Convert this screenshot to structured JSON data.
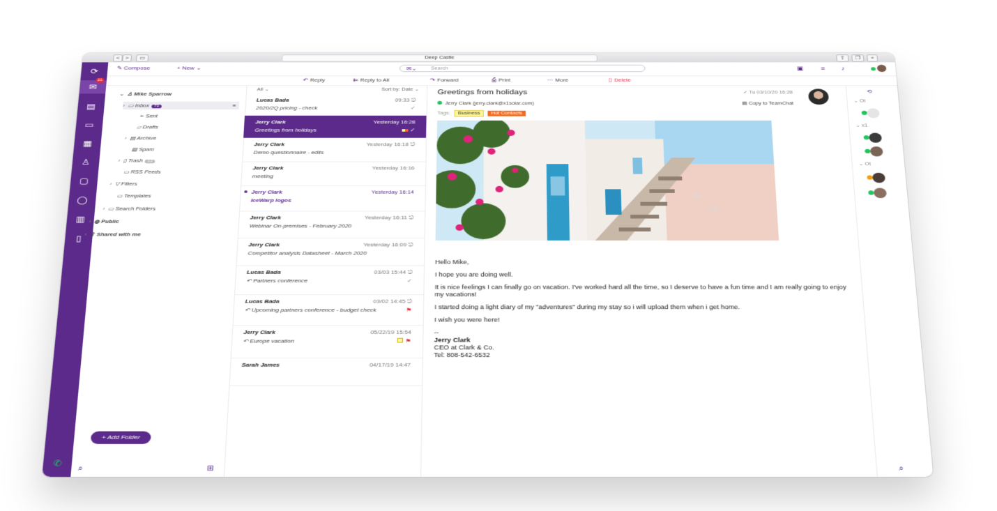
{
  "browser": {
    "url_title": "Deep Castle",
    "nav": [
      "<",
      ">"
    ]
  },
  "rail": {
    "mail_badge": "21"
  },
  "toolbar": {
    "compose_label": "Compose",
    "new_label": "+ New",
    "search_placeholder": "Search"
  },
  "actions": {
    "reply": "Reply",
    "reply_all": "Reply to All",
    "forward": "Forward",
    "print": "Print",
    "more": "More",
    "delete": "Delete"
  },
  "folders": {
    "account": "Mike Sparrow",
    "inbox": "Inbox",
    "inbox_count": "73",
    "sent": "Sent",
    "drafts": "Drafts",
    "archive": "Archive",
    "spam": "Spam",
    "trash": "Trash",
    "trash_count": "12",
    "rss": "RSS Feeds",
    "filters": "Filters",
    "templates": "Templates",
    "search_folders": "Search Folders",
    "public": "Public",
    "shared": "Shared with me",
    "add_folder": "Add Folder"
  },
  "list": {
    "filter": "All",
    "sort_label": "Sort by:",
    "sort_value": "Date",
    "messages": [
      {
        "from": "Lucas Bada",
        "time": "09:33",
        "subject": "2020/2Q pricing - check"
      },
      {
        "from": "Jerry Clark",
        "time": "Yesterday 16:28",
        "subject": "Greetings from holidays"
      },
      {
        "from": "Jerry Clark",
        "time": "Yesterday 16:18",
        "subject": "Demo questionnaire - edits"
      },
      {
        "from": "Jerry Clark",
        "time": "Yesterday 16:16",
        "subject": "meeting"
      },
      {
        "from": "Jerry Clark",
        "time": "Yesterday 16:14",
        "subject": "IceWarp logos"
      },
      {
        "from": "Jerry Clark",
        "time": "Yesterday 16:11",
        "subject": "Webinar On-premises - February 2020"
      },
      {
        "from": "Jerry Clark",
        "time": "Yesterday 16:09",
        "subject": "Competitor analysis Datasheet - March 2020"
      },
      {
        "from": "Lucas Bada",
        "time": "03/03 15:44",
        "subject": "Partners conference"
      },
      {
        "from": "Lucas Bada",
        "time": "03/02 14:45",
        "subject": "Upcoming partners conference - budget check"
      },
      {
        "from": "Jerry Clark",
        "time": "05/22/19 15:54",
        "subject": "Europe vacation"
      },
      {
        "from": "Sarah James",
        "time": "04/17/19 14:47",
        "subject": ""
      }
    ]
  },
  "reader": {
    "title": "Greetings from holidays",
    "date": "Tu 03/10/20 16:28",
    "from": "Jerry Clark (jerry.clark@x1solar.com)",
    "copy_to": "Copy to TeamChat",
    "tags_label": "Tags:",
    "tag1": "Business",
    "tag2": "Hot Contacts",
    "greeting": "Hello Mike,",
    "p1": "I hope you are doing well.",
    "p2": "It is nice feelings I can finally go on vacation. I've worked hard all the time, so I deserve to have a fun time and I am really going to enjoy my vacations!",
    "p3": "I started doing a light diary of my \"adventures\" during my stay so i will upload them when i get home.",
    "p4": "I wish you were here!",
    "dash": "--",
    "sig_name": "Jerry Clark",
    "sig_title": "CEO at Clark & Co.",
    "sig_tel": "Tel: 808-542-6532"
  },
  "people": {
    "g1": "Ot",
    "g2": "x1",
    "g3": "Ot"
  },
  "colors": {
    "brand": "#5c2a8a",
    "online": "#22c55e",
    "away": "#f59e0b",
    "flag": "#e02b3b",
    "hot_tag": "#f36b21"
  }
}
